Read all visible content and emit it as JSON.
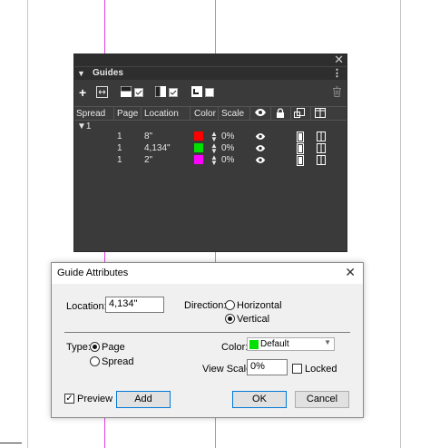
{
  "colors": {
    "guide_magenta": "#e040e0",
    "guide_green": "#40e040",
    "panel_bg": "#3a3a3a",
    "swatch_red": "#ff0000",
    "swatch_green": "#00e000",
    "swatch_magenta": "#ff00ff"
  },
  "panel": {
    "title": "Guides",
    "headers": {
      "spread": "Spread",
      "page": "Page",
      "location": "Location",
      "color": "Color",
      "scale": "Scale"
    },
    "spread_label": "▼1",
    "rows": [
      {
        "page": "1",
        "location": "8\"",
        "color_icon": "red-swatch",
        "scale": "0%"
      },
      {
        "page": "1",
        "location": "4,134\"",
        "color_icon": "green-swatch",
        "scale": "0%"
      },
      {
        "page": "1",
        "location": "2\"",
        "color_icon": "magenta-swatch",
        "scale": "0%"
      }
    ]
  },
  "dialog": {
    "title": "Guide Attributes",
    "location_label": "Location:",
    "location_value": "4,134\"",
    "direction_label": "Direction:",
    "direction_options": [
      "Horizontal",
      "Vertical"
    ],
    "direction_selected": "Vertical",
    "type_label": "Type:",
    "type_options": [
      "Page",
      "Spread"
    ],
    "type_selected": "Page",
    "color_label": "Color:",
    "color_value": "Default",
    "view_scale_label": "View Scale:",
    "view_scale_value": "0%",
    "locked_label": "Locked",
    "locked_checked": false,
    "preview_label": "Preview",
    "preview_checked": true,
    "add_label": "Add",
    "ok_label": "OK",
    "cancel_label": "Cancel"
  }
}
